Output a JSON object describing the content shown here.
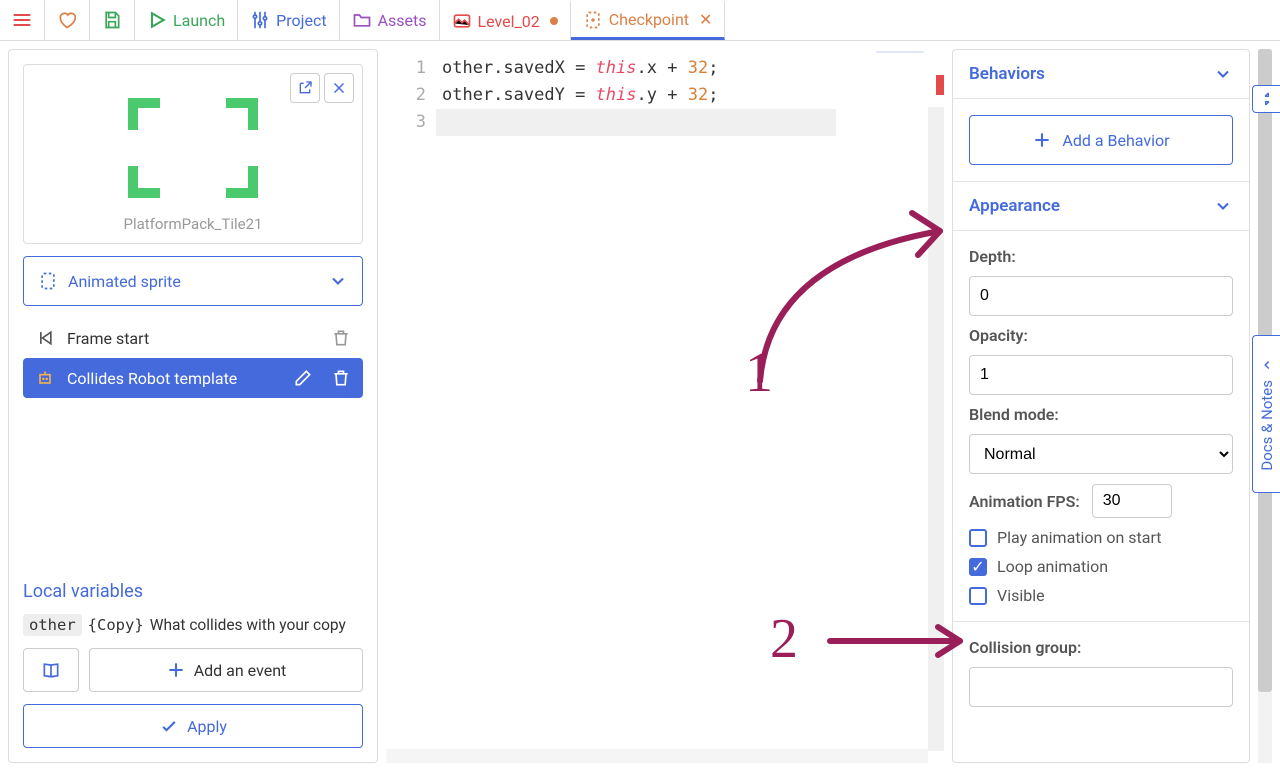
{
  "toolbar": {
    "launch": "Launch",
    "project": "Project",
    "assets": "Assets"
  },
  "tabs": {
    "level": "Level_02",
    "checkpoint": "Checkpoint"
  },
  "left": {
    "preview_name": "PlatformPack_Tile21",
    "class_dropdown": "Animated sprite",
    "events": {
      "frame_start": "Frame start",
      "collides_robot": "Collides Robot template"
    },
    "local_variables_title": "Local variables",
    "var_other": "other",
    "var_copy": "Copy",
    "var_desc": "What collides with your copy",
    "add_event": "Add an event",
    "apply": "Apply"
  },
  "code": {
    "lines": [
      {
        "n": "1",
        "xvar": "savedX",
        "axis": "x",
        "offset": "32"
      },
      {
        "n": "2",
        "xvar": "savedY",
        "axis": "y",
        "offset": "32"
      },
      {
        "n": "3"
      }
    ]
  },
  "right": {
    "behaviors_title": "Behaviors",
    "add_behavior": "Add a Behavior",
    "appearance_title": "Appearance",
    "depth_label": "Depth:",
    "depth_value": "0",
    "opacity_label": "Opacity:",
    "opacity_value": "1",
    "blend_label": "Blend mode:",
    "blend_value": "Normal",
    "fps_label": "Animation FPS:",
    "fps_value": "30",
    "play_on_start": "Play animation on start",
    "loop_anim": "Loop animation",
    "visible": "Visible",
    "collision_label": "Collision group:"
  },
  "docs_tab": "Docs & Notes",
  "annotations": {
    "one": "1",
    "two": "2"
  }
}
